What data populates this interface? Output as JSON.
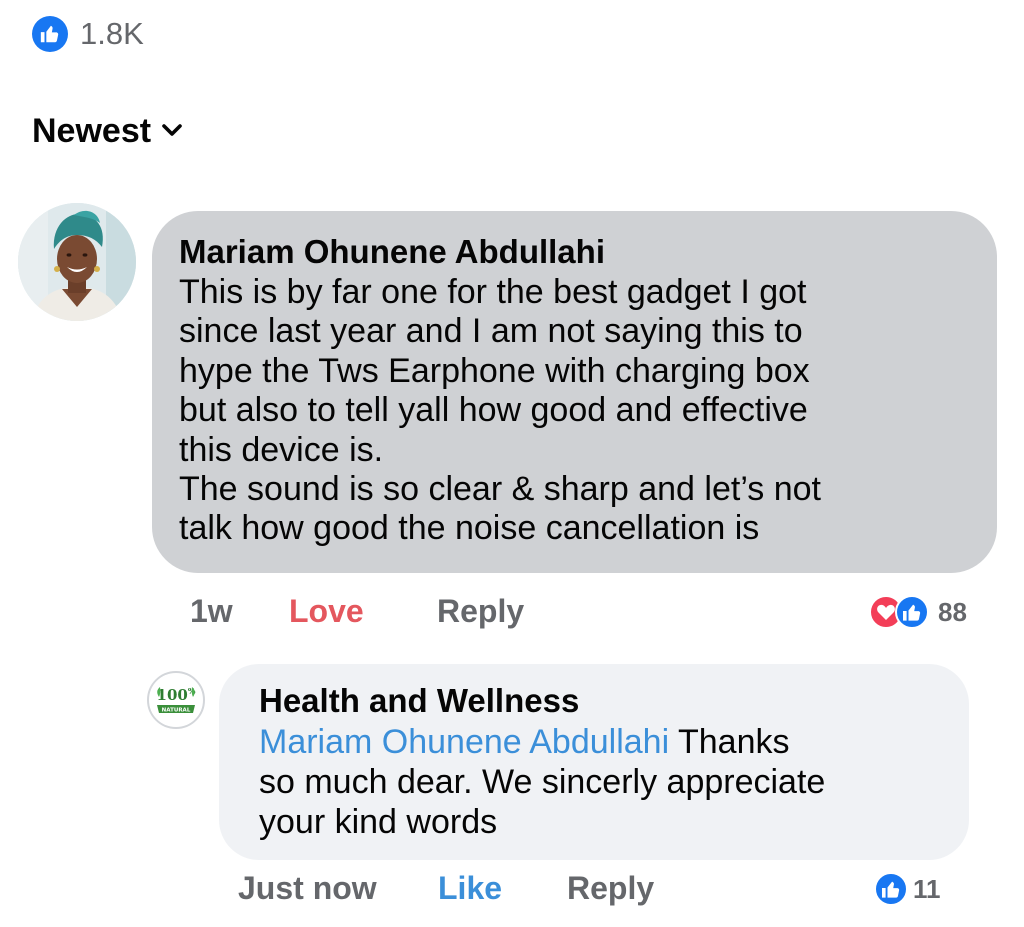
{
  "post": {
    "like_count": "1.8K"
  },
  "sort": {
    "label": "Newest"
  },
  "comments": [
    {
      "author": "Mariam Ohunene Abdullahi",
      "lines": [
        "This is by far one for the best gadget I got",
        "since last year and I am not saying this to",
        "hype the Tws Earphone with charging box",
        "but also to tell yall how good and effective",
        "this device is.",
        "The sound is so clear & sharp and let’s not",
        "talk how good the noise cancellation is"
      ],
      "time": "1w",
      "reaction_label": "Love",
      "reply_label": "Reply",
      "reaction_count": "88"
    },
    {
      "author": "Health and Wellness",
      "mention": "Mariam Ohunene Abdullahi",
      "text_after_mention_line1": "Thanks",
      "lines": [
        "so much dear. We sincerly appreciate",
        "your kind words"
      ],
      "time": "Just now",
      "reaction_label": "Like",
      "reply_label": "Reply",
      "reaction_count": "11",
      "avatar_logo_text": "100% NATURAL"
    }
  ],
  "colors": {
    "facebook_blue": "#1877f2",
    "love_red": "#f33e58",
    "mention_blue": "#3b8fd9",
    "secondary_text": "#65676b"
  },
  "icons": {
    "like": "like-thumb-icon",
    "love": "love-heart-icon",
    "sort_chevron": "chevron-down-icon"
  }
}
